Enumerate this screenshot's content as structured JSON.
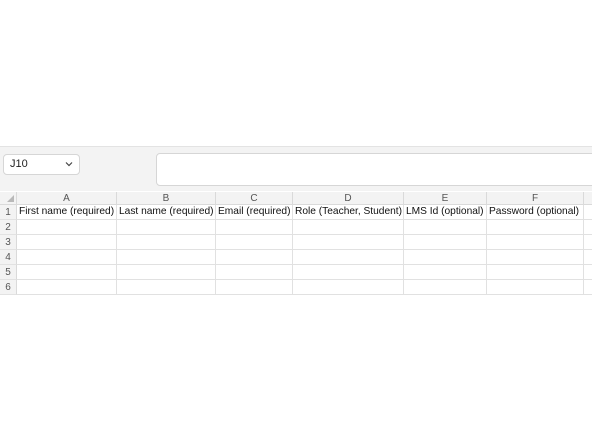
{
  "name_box": {
    "value": "J10"
  },
  "formula_bar": {
    "value": ""
  },
  "columns": [
    "A",
    "B",
    "C",
    "D",
    "E",
    "F"
  ],
  "rows": [
    "1",
    "2",
    "3",
    "4",
    "5",
    "6"
  ],
  "header_row": [
    "First name (required)",
    "Last name (required)",
    "Email (required)",
    "Role (Teacher, Student)",
    "LMS Id (optional)",
    "Password (optional)"
  ],
  "icons": {
    "name_box_dropdown": "chevron-down-icon",
    "select_all": "select-all-triangle-icon"
  }
}
